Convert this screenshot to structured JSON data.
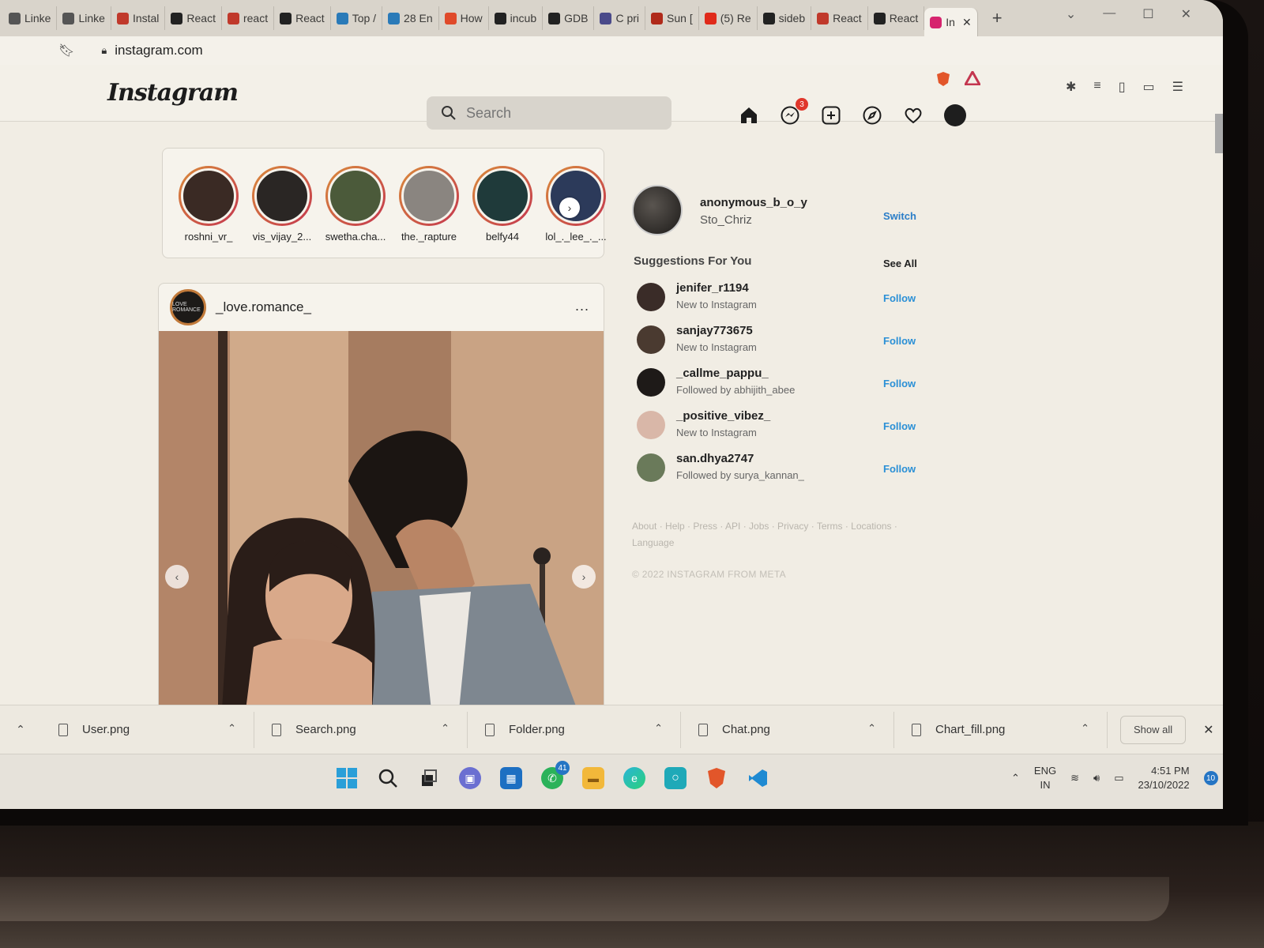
{
  "browser": {
    "tabs": [
      {
        "label": "Linke",
        "color": "#555555"
      },
      {
        "label": "Linke",
        "color": "#555555"
      },
      {
        "label": "Instal",
        "color": "#c0392b"
      },
      {
        "label": "React",
        "color": "#222222"
      },
      {
        "label": "react",
        "color": "#c0392b"
      },
      {
        "label": "React",
        "color": "#222222"
      },
      {
        "label": "Top /",
        "color": "#2a7ab8"
      },
      {
        "label": "28 En",
        "color": "#2a7ab8"
      },
      {
        "label": "How",
        "color": "#e04a2a"
      },
      {
        "label": "incub",
        "color": "#222222"
      },
      {
        "label": "GDB",
        "color": "#222222"
      },
      {
        "label": "C pri",
        "color": "#4a4a8a"
      },
      {
        "label": "Sun [",
        "color": "#b02a1a"
      },
      {
        "label": "(5) Re",
        "color": "#e02a1a"
      },
      {
        "label": "sideb",
        "color": "#222222"
      },
      {
        "label": "React",
        "color": "#c0392b"
      },
      {
        "label": "React",
        "color": "#222222"
      }
    ],
    "active_tab": {
      "label": "In",
      "color": "#d6246e"
    },
    "url": "instagram.com",
    "window_controls": {
      "minimize": "—",
      "maximize": "☐",
      "close": "✕"
    }
  },
  "instagram": {
    "logo": "Instagram",
    "search": {
      "placeholder": "Search"
    },
    "messages_badge": "3",
    "stories": [
      {
        "name": "roshni_vr_",
        "color": "#3a2a24"
      },
      {
        "name": "vis_vijay_2...",
        "color": "#2a2624"
      },
      {
        "name": "swetha.cha...",
        "color": "#4b5a3a"
      },
      {
        "name": "the._rapture",
        "color": "#8a8580"
      },
      {
        "name": "belfy44",
        "color": "#1f3a3a"
      },
      {
        "name": "lol_._lee_._...",
        "color": "#2c3a5a"
      }
    ],
    "post": {
      "username": "_love.romance_",
      "avatar_text": "LOVE ROMANCE",
      "more": "..."
    },
    "current_user": {
      "username": "anonymous_b_o_y",
      "name": "Sto_Chriz",
      "switch_label": "Switch"
    },
    "suggestions": {
      "title": "Suggestions For You",
      "see_all": "See All",
      "items": [
        {
          "username": "jenifer_r1194",
          "sub": "New to Instagram",
          "action": "Follow",
          "color": "#3a2c28"
        },
        {
          "username": "sanjay773675",
          "sub": "New to Instagram",
          "action": "Follow",
          "color": "#4a3a30"
        },
        {
          "username": "_callme_pappu_",
          "sub": "Followed by abhijith_abee",
          "action": "Follow",
          "color": "#1e1a18"
        },
        {
          "username": "_positive_vibez_",
          "sub": "New to Instagram",
          "action": "Follow",
          "color": "#d9b7a8"
        },
        {
          "username": "san.dhya2747",
          "sub": "Followed by surya_kannan_",
          "action": "Follow",
          "color": "#6a7a5a"
        }
      ]
    },
    "footer_links": "About · Help · Press · API · Jobs · Privacy · Terms · Locations · Language",
    "copyright": "© 2022 INSTAGRAM FROM META"
  },
  "downloads": {
    "items": [
      {
        "name": "User.png"
      },
      {
        "name": "Search.png"
      },
      {
        "name": "Folder.png"
      },
      {
        "name": "Chat.png"
      },
      {
        "name": "Chart_fill.png"
      }
    ],
    "show_all": "Show all"
  },
  "taskbar": {
    "whatsapp_badge": "41",
    "lang_top": "ENG",
    "lang_bottom": "IN",
    "time": "4:51 PM",
    "date": "23/10/2022",
    "notifications": "10"
  }
}
